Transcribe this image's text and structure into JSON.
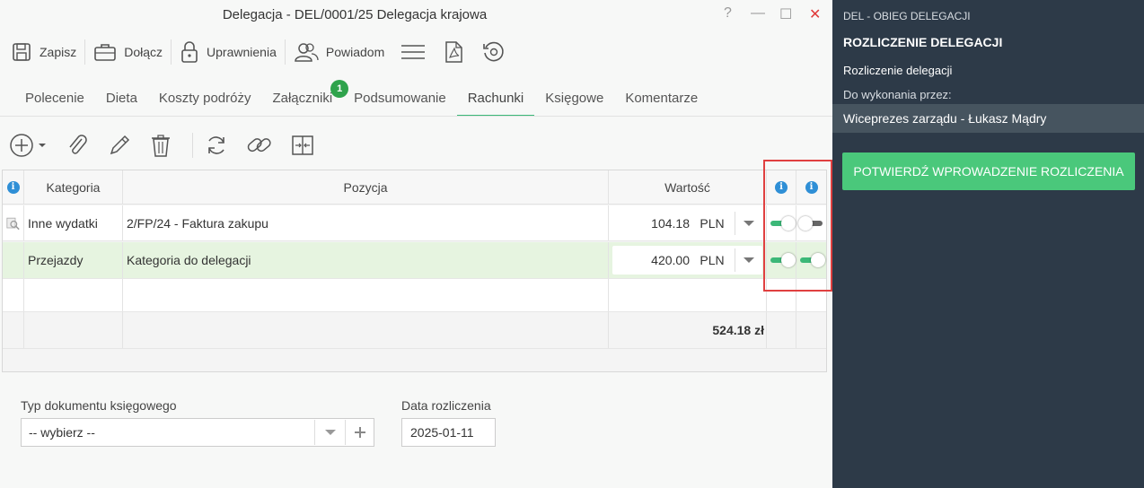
{
  "window": {
    "title": "Delegacja - DEL/0001/25 Delegacja krajowa",
    "help": "?",
    "minimize": "—",
    "maximize": "☐",
    "close": "✕"
  },
  "toolbar": {
    "save": "Zapisz",
    "attach": "Dołącz",
    "permissions": "Uprawnienia",
    "notify": "Powiadom"
  },
  "tabs": [
    {
      "label": "Polecenie"
    },
    {
      "label": "Dieta"
    },
    {
      "label": "Koszty podróży"
    },
    {
      "label": "Załączniki",
      "badge": "1"
    },
    {
      "label": "Podsumowanie"
    },
    {
      "label": "Rachunki",
      "active": true
    },
    {
      "label": "Księgowe"
    },
    {
      "label": "Komentarze"
    }
  ],
  "grid": {
    "headers": {
      "info": "i",
      "category": "Kategoria",
      "position": "Pozycja",
      "value": "Wartość",
      "info2": "i",
      "info3": "i"
    },
    "rows": [
      {
        "category": "Inne wydatki",
        "position": "2/FP/24 - Faktura zakupu",
        "value": "104.18",
        "currency": "PLN",
        "toggle1": true,
        "toggle2": false
      },
      {
        "category": "Przejazdy",
        "position": "Kategoria do delegacji",
        "value": "420.00",
        "currency": "PLN",
        "toggle1": true,
        "toggle2": true
      }
    ],
    "total": "524.18 zł"
  },
  "form": {
    "doc_type_label": "Typ dokumentu księgowego",
    "doc_type_value": "-- wybierz --",
    "date_label": "Data rozliczenia",
    "date_value": "2025-01-11"
  },
  "sidebar": {
    "process": "DEL - OBIEG DELEGACJI",
    "title": "ROZLICZENIE DELEGACJI",
    "step": "Rozliczenie delegacji",
    "assigned_label": "Do wykonania przez:",
    "assignee": "Wiceprezes zarządu - Łukasz Mądry",
    "confirm_button": "POTWIERDŹ WPROWADZENIE ROZLICZENIA"
  },
  "colors": {
    "accent": "#3cb878",
    "sidebar_bg": "#2d3a48",
    "button_green": "#4ac87b",
    "highlight": "#e04040",
    "info": "#2f8fd6"
  }
}
